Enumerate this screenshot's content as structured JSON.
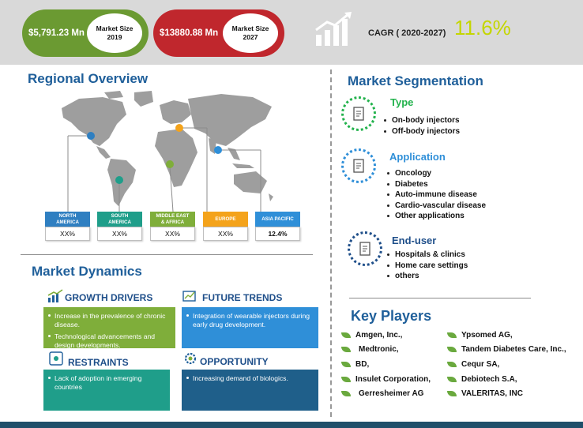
{
  "header": {
    "size_2019_value": "$5,791.23 Mn",
    "size_2019_label_line1": "Market Size",
    "size_2019_label_line2": "2019",
    "size_2027_value": "$13880.88 Mn",
    "size_2027_label_line1": "Market Size",
    "size_2027_label_line2": "2027",
    "cagr_label": "CAGR ( 2020-2027)",
    "cagr_value": "11.6%"
  },
  "colors": {
    "green": "#6b9a32",
    "red": "#c0272d",
    "blue_title": "#1f5f9a",
    "cagr": "#c4d600",
    "map": "#9e9e9e"
  },
  "regional": {
    "title": "Regional Overview",
    "regions": [
      {
        "name_line1": "NORTH",
        "name_line2": "AMERICA",
        "value": "XX%",
        "color": "#2f7fc1",
        "dot_color": "#2f7fc1"
      },
      {
        "name_line1": "SOUTH",
        "name_line2": "AMERICA",
        "value": "XX%",
        "color": "#1f9e8a",
        "dot_color": "#1f9e8a"
      },
      {
        "name_line1": "MIDDLE EAST",
        "name_line2": "& AFRICA",
        "value": "XX%",
        "color": "#7fae3a",
        "dot_color": "#7fae3a"
      },
      {
        "name_line1": "EUROPE",
        "name_line2": "",
        "value": "XX%",
        "color": "#f4a31b",
        "dot_color": "#f4a31b"
      },
      {
        "name_line1": "ASIA PACIFIC",
        "name_line2": "",
        "value": "12.4%",
        "color": "#2f8fd8",
        "dot_color": "#2f8fd8"
      }
    ]
  },
  "dynamics": {
    "title": "Market Dynamics",
    "growth_drivers": {
      "title": "GROWTH DRIVERS",
      "items": [
        "Increase in the prevalence of chronic disease.",
        "Technological advancements and design developments."
      ]
    },
    "future_trends": {
      "title": "FUTURE TRENDS",
      "items": [
        "Integration of wearable injectors during early drug development."
      ]
    },
    "restraints": {
      "title": "RESTRAINTS",
      "items": [
        "Lack of adoption in emerging countries"
      ]
    },
    "opportunity": {
      "title": "OPPORTUNITY",
      "items": [
        "Increasing demand of biologics."
      ]
    }
  },
  "segmentation": {
    "title": "Market Segmentation",
    "type": {
      "title": "Type",
      "items": [
        "On-body injectors",
        "Off-body injectors"
      ]
    },
    "application": {
      "title": "Application",
      "items": [
        "Oncology",
        "Diabetes",
        "Auto-immune disease",
        "Cardio-vascular disease",
        "Other applications"
      ]
    },
    "end_user": {
      "title": "End-user",
      "items": [
        "Hospitals & clinics",
        "Home care settings",
        "others"
      ]
    }
  },
  "key_players": {
    "title": "Key Players",
    "left": [
      "Amgen, Inc.,",
      "Medtronic,",
      "BD,",
      "Insulet Corporation,",
      "Gerresheimer AG"
    ],
    "right": [
      "Ypsomed AG,",
      "Tandem Diabetes Care, Inc.,",
      "Cequr SA,",
      "Debiotech S.A,",
      "VALERITAS, INC"
    ]
  },
  "icons": {
    "chart_growth": "bar-chart-growth-icon",
    "growth": "growth-chart-icon",
    "trends": "trend-chart-icon",
    "restraints": "restraint-icon",
    "opportunity": "opportunity-gear-icon",
    "segment": "document-icon",
    "leaf": "leaf-bullet-icon"
  }
}
